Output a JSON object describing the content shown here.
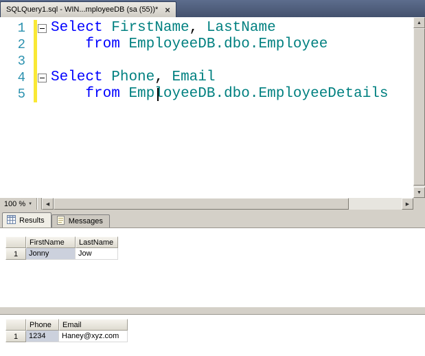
{
  "colors": {
    "keyword": "#0000ff",
    "identifier": "#008080",
    "line_number": "#2b91af",
    "change_bar_yellow": "#f9e835",
    "tabstrip_bg": "#43516d",
    "panel_bg": "#d4d0c8"
  },
  "document_tab": {
    "title": "SQLQuery1.sql - WIN...mployeeDB (sa (55))*",
    "close_glyph": "×"
  },
  "editor": {
    "zoom_level": "100 %",
    "lines": [
      {
        "num": "1",
        "segs": [
          {
            "t": "Select"
          },
          {
            "t": " "
          },
          {
            "t": "FirstName"
          },
          {
            "t": ", "
          },
          {
            "t": "LastName"
          }
        ]
      },
      {
        "num": "2",
        "segs": [
          {
            "t": "    "
          },
          {
            "t": "from"
          },
          {
            "t": " "
          },
          {
            "t": "EmployeeDB.dbo.Employee"
          }
        ]
      },
      {
        "num": "3",
        "segs": []
      },
      {
        "num": "4",
        "segs": [
          {
            "t": "Select"
          },
          {
            "t": " "
          },
          {
            "t": "Phone"
          },
          {
            "t": ", "
          },
          {
            "t": "Email"
          }
        ]
      },
      {
        "num": "5",
        "segs": [
          {
            "t": "    "
          },
          {
            "t": "from"
          },
          {
            "t": " "
          },
          {
            "t": "EmployeeDB.dbo.EmployeeDetails"
          }
        ]
      }
    ]
  },
  "icons": {
    "scroll_up": "▲",
    "scroll_down": "▼",
    "scroll_left": "◀",
    "scroll_right": "▶",
    "zoom_caret": "▼"
  },
  "results_tabs": {
    "results": "Results",
    "messages": "Messages"
  },
  "grid1": {
    "columns": [
      "FirstName",
      "LastName"
    ],
    "row_number": "1",
    "cells": [
      "Jonny",
      "Jow"
    ]
  },
  "grid2": {
    "columns": [
      "Phone",
      "Email"
    ],
    "row_number": "1",
    "cells": [
      "1234",
      "Haney@xyz.com"
    ]
  }
}
